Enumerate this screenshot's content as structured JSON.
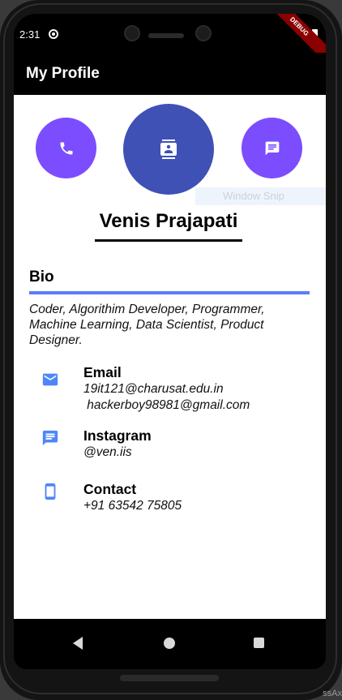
{
  "status_bar": {
    "time": "2:31",
    "debug_label": "DEBUG"
  },
  "app_bar": {
    "title": "My Profile"
  },
  "actions": [
    {
      "name": "call",
      "icon": "phone-icon"
    },
    {
      "name": "contact",
      "icon": "contact-card-icon"
    },
    {
      "name": "message",
      "icon": "chat-icon"
    }
  ],
  "overlay": {
    "window_snip": "Window Snip"
  },
  "profile": {
    "name": "Venis Prajapati"
  },
  "bio": {
    "title": "Bio",
    "text": "Coder, Algorithim Developer, Programmer, Machine Learning, Data Scientist, Product Designer."
  },
  "info": {
    "email": {
      "label": "Email",
      "values": [
        "19it121@charusat.edu.in",
        " hackerboy98981@gmail.com"
      ]
    },
    "instagram": {
      "label": "Instagram",
      "value": "@ven.iis"
    },
    "contact": {
      "label": "Contact",
      "value": "+91 63542 75805"
    }
  },
  "colors": {
    "accent_purple": "#7c4dff",
    "accent_indigo": "#3f51b5",
    "bio_rule": "#5c7cfa",
    "icon_blue": "#4f86f7"
  },
  "background": {
    "corner_text": "ssAx"
  }
}
